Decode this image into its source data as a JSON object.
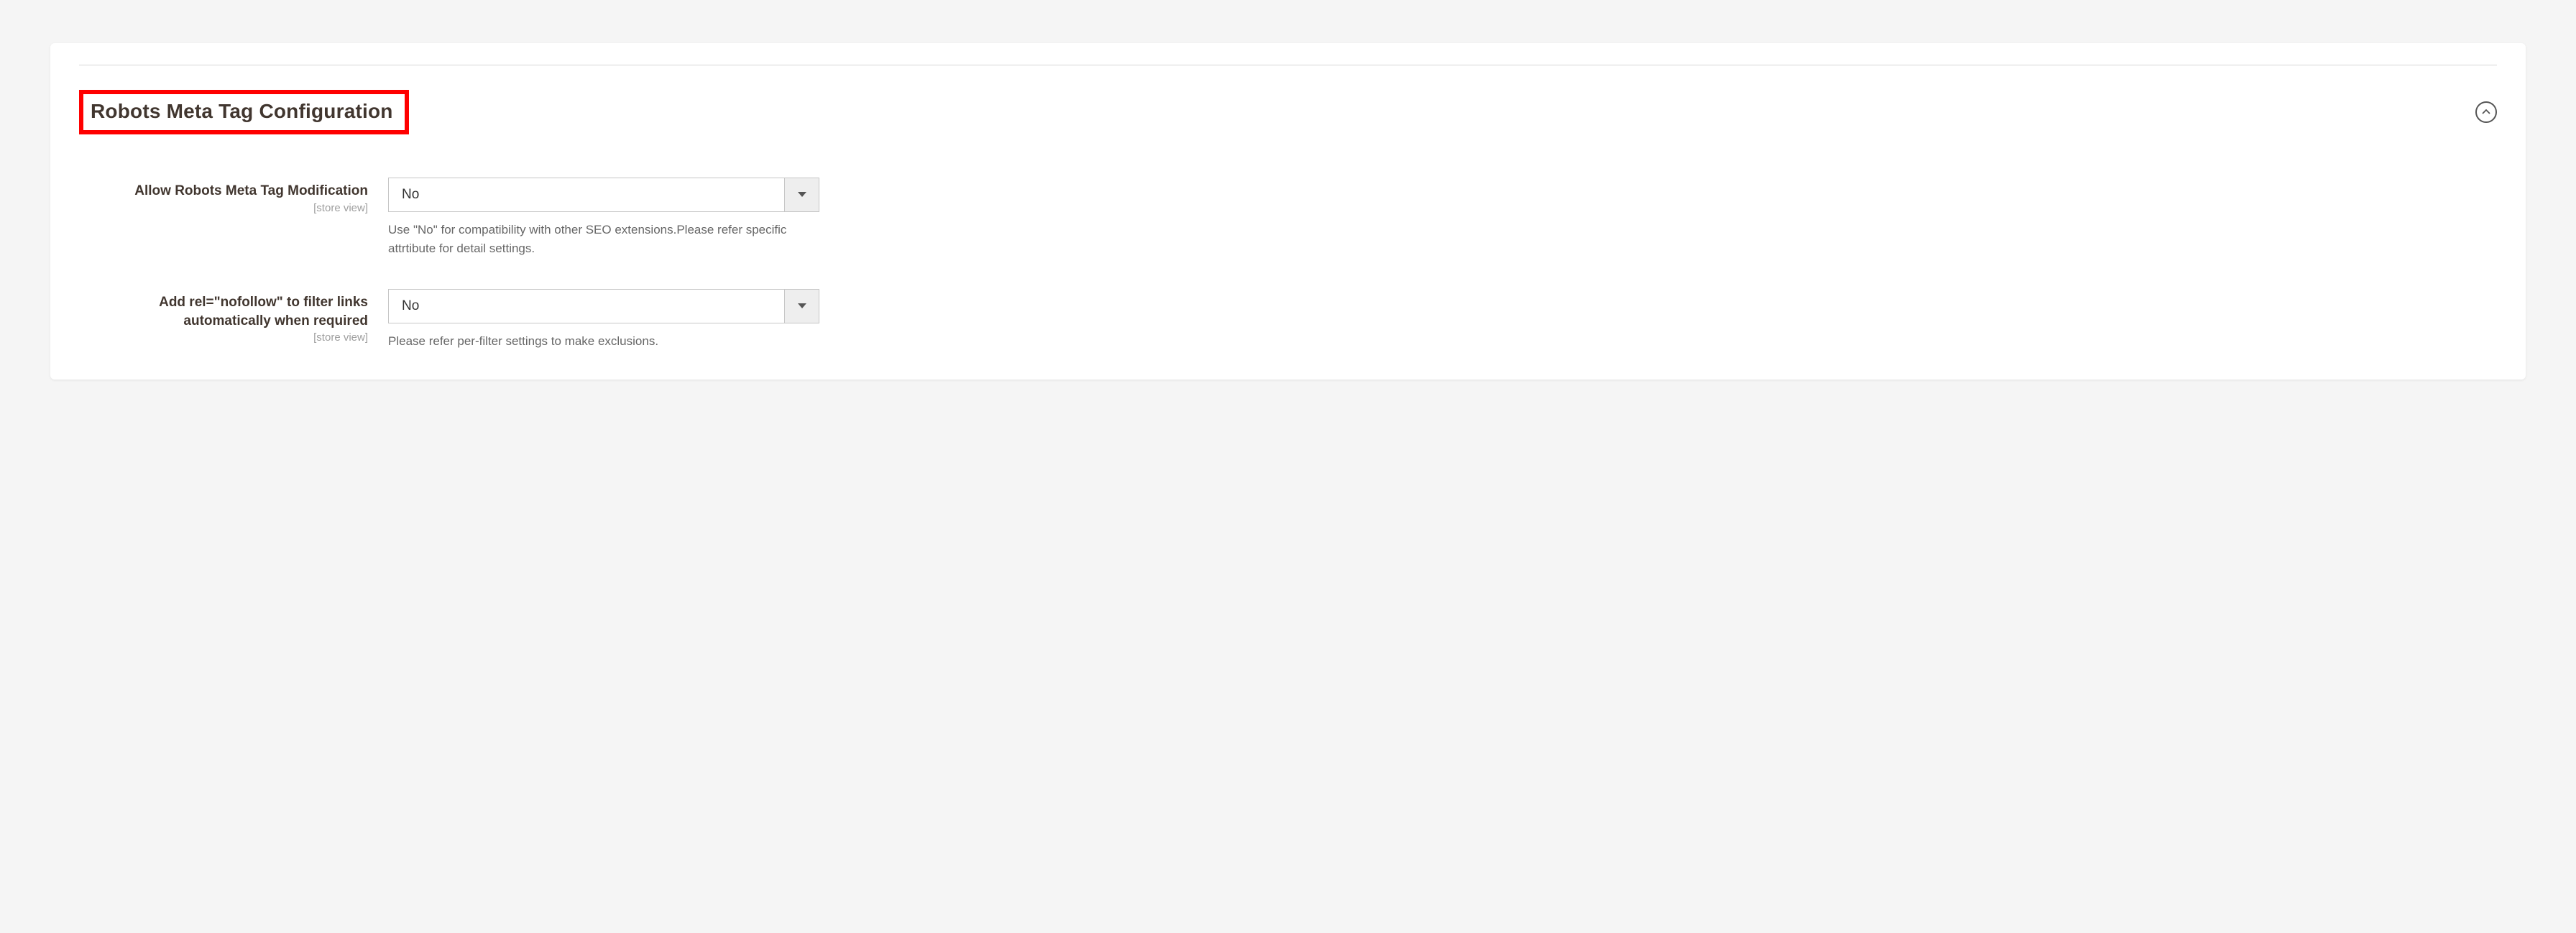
{
  "section": {
    "title": "Robots Meta Tag Configuration"
  },
  "fields": {
    "allow_modification": {
      "label": "Allow Robots Meta Tag Modification",
      "scope": "[store view]",
      "value": "No",
      "hint": "Use \"No\" for compatibility with other SEO extensions.Please refer specific attrtibute for detail settings."
    },
    "nofollow": {
      "label": "Add rel=\"nofollow\" to filter links automatically when required",
      "scope": "[store view]",
      "value": "No",
      "hint": "Please refer per-filter settings to make exclusions."
    }
  }
}
